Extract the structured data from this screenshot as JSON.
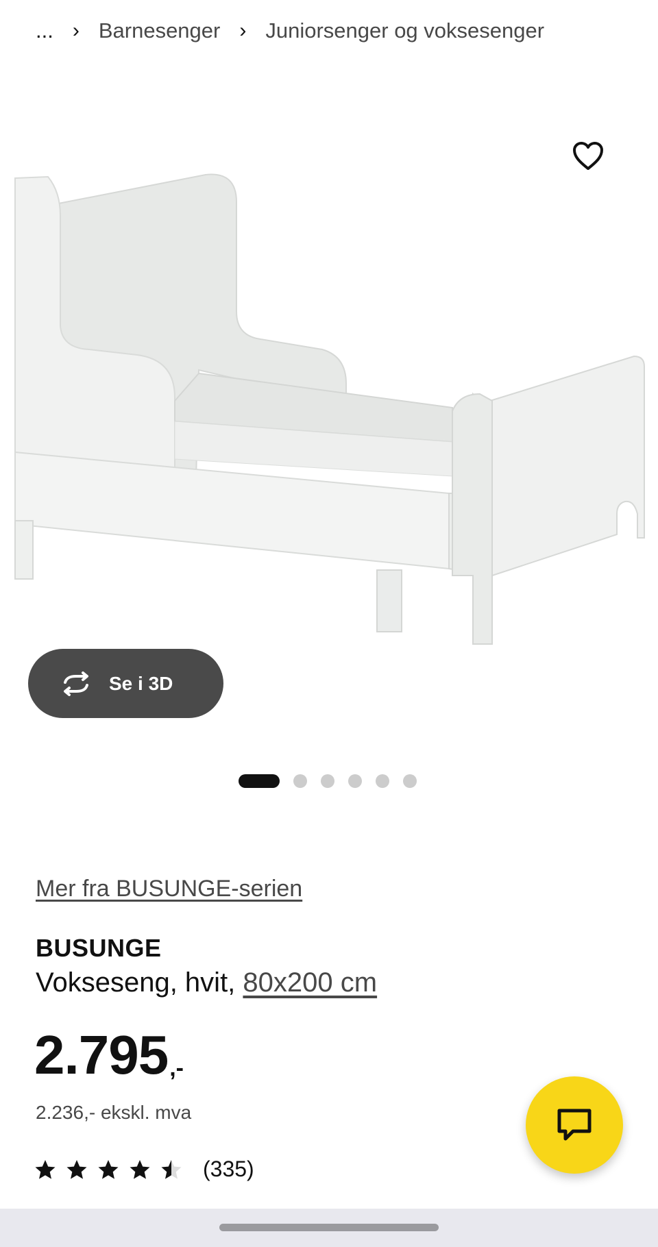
{
  "breadcrumb": {
    "ellipsis": "...",
    "items": [
      "Barnesenger",
      "Juniorsenger og voksesenger"
    ]
  },
  "hero": {
    "favorite_icon": "heart-icon",
    "view_3d_label": "Se i 3D",
    "view_3d_icon": "rotate-3d-icon",
    "carousel": {
      "total": 6,
      "active_index": 0
    }
  },
  "product": {
    "series_link": "Mer fra BUSUNGE-serien",
    "name": "BUSUNGE",
    "description_prefix": "Vokseseng, hvit,",
    "size_link": "80x200 cm",
    "price_integer": "2.795",
    "price_decimal": ",-",
    "price_excl_vat": "2.236,- ekskl. mva",
    "rating": {
      "value": 4.5,
      "max": 5,
      "count_label": "(335)"
    }
  },
  "chat": {
    "icon": "chat-bubble-icon"
  },
  "colors": {
    "accent_yellow": "#f8d618",
    "button_dark": "#4a4a4a",
    "text_primary": "#111111",
    "text_secondary": "#484848"
  }
}
